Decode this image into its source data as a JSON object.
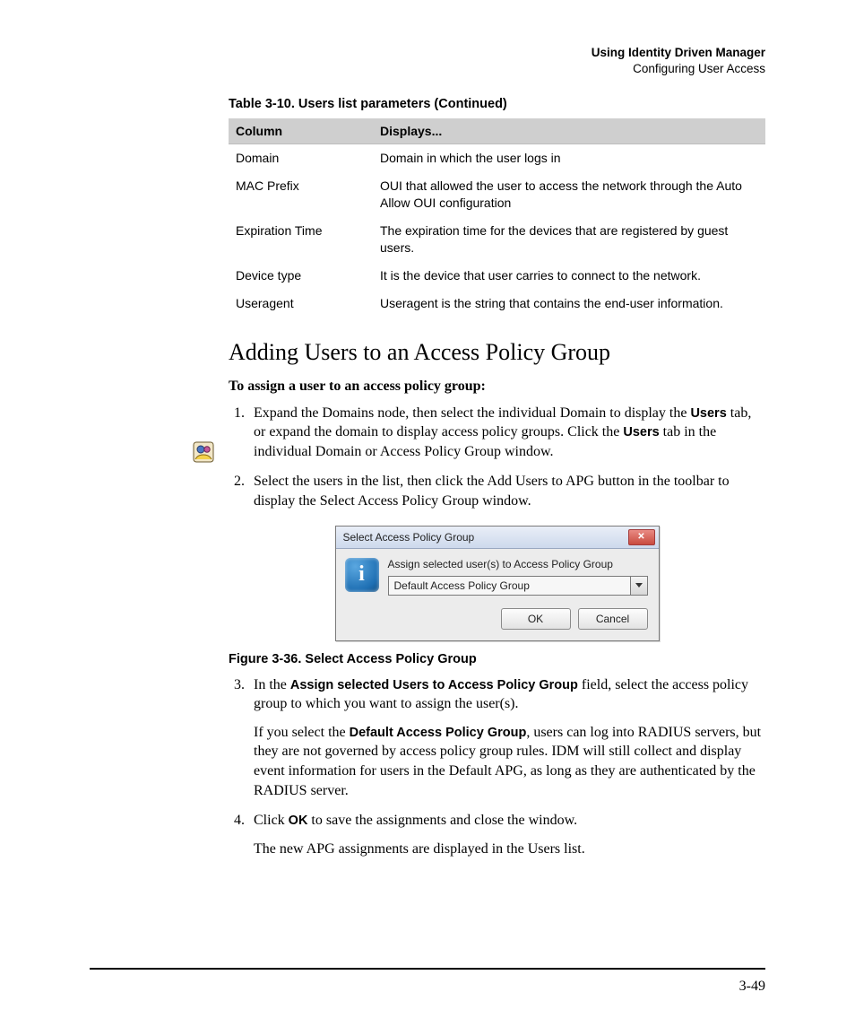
{
  "header": {
    "line1": "Using Identity Driven Manager",
    "line2": "Configuring User Access"
  },
  "table": {
    "caption": "Table 3-10.   Users list parameters (Continued)",
    "col1": "Column",
    "col2": "Displays...",
    "rows": [
      {
        "c1": "Domain",
        "c2": "Domain in which the user logs in"
      },
      {
        "c1": "MAC Prefix",
        "c2": "OUI that allowed the user to access the network through the Auto Allow OUI configuration"
      },
      {
        "c1": "Expiration Time",
        "c2": " The expiration time for the devices that are registered by guest users."
      },
      {
        "c1": "Device type",
        "c2": "It is the device that user carries to connect to the network."
      },
      {
        "c1": "Useragent",
        "c2": "Useragent is the string that contains the end-user information."
      }
    ]
  },
  "section_heading": "Adding Users to an Access Policy Group",
  "lead": "To assign a user to an access policy group:",
  "steps": {
    "s1_a": "Expand the Domains node, then select the individual Domain to display the ",
    "s1_b": "Users",
    "s1_c": " tab, or expand the domain to display access policy groups. Click the ",
    "s1_d": "Users",
    "s1_e": " tab in the individual Domain or Access Policy Group window.",
    "s2": "Select the users in the list, then click the Add Users to APG button in the toolbar to display the Select Access Policy Group window.",
    "s3_a": "In the ",
    "s3_b": "Assign selected Users to Access Policy Group",
    "s3_c": " field, select the access policy group to which you want to assign the user(s).",
    "s3_p2_a": "If you select the ",
    "s3_p2_b": "Default Access Policy Group",
    "s3_p2_c": ", users can log into RADIUS servers, but they are not governed by access policy group rules. IDM will still collect and display event information for users in the Default APG, as long as they are authenticated by the RADIUS server.",
    "s4_a": "Click ",
    "s4_b": "OK",
    "s4_c": " to save the assignments and close the window.",
    "s4_p2": "The new APG assignments are displayed in the Users list."
  },
  "dialog": {
    "title": "Select Access Policy Group",
    "message": "Assign selected user(s) to Access Policy Group",
    "selected": "Default Access Policy Group",
    "ok": "OK",
    "cancel": "Cancel"
  },
  "figure_caption": "Figure 3-36. Select Access Policy Group",
  "page_number": "3-49"
}
